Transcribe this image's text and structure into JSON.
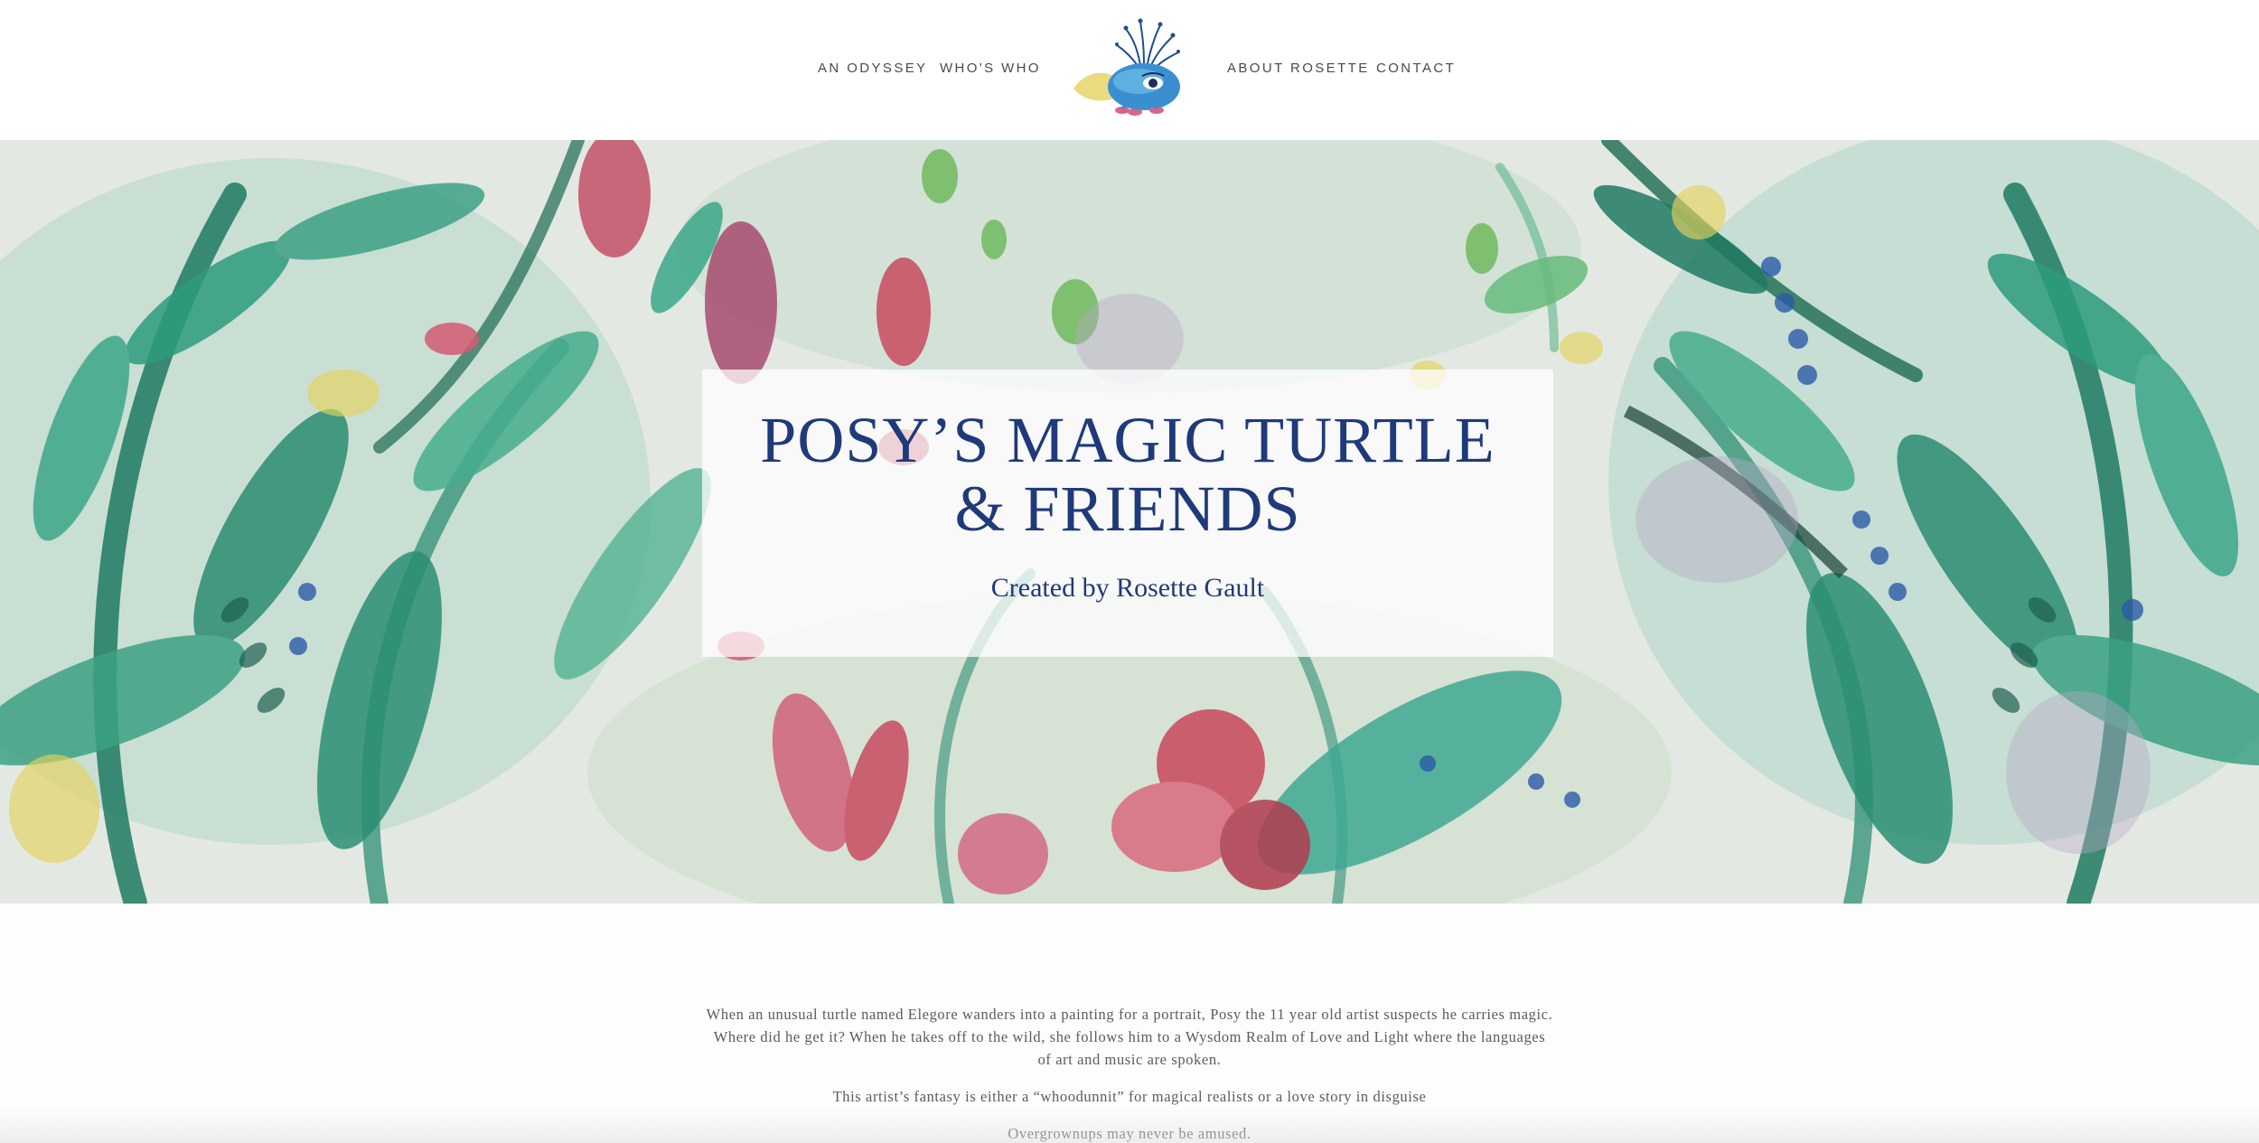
{
  "nav": {
    "left_items": [
      {
        "label": "AN ODYSSEY"
      },
      {
        "label": "WHO'S WHO"
      }
    ],
    "right_items": [
      {
        "label": "ABOUT ROSETTE"
      },
      {
        "label": "CONTACT"
      }
    ],
    "logo_icon": "turtle-creature-logo-icon"
  },
  "hero": {
    "title_line1": "POSY’S MAGIC TURTLE",
    "title_line2": "& FRIENDS",
    "subtitle": "Created by Rosette Gault",
    "background_icon": "watercolor-foliage-painting"
  },
  "content": {
    "paragraphs": [
      "When an unusual turtle named Elegore wanders into a painting for a portrait, Posy the 11 year old artist suspects he carries magic. Where did he get it? When he takes off to the wild, she follows him to a Wysdom Realm of Love and Light where the languages of art and music are spoken.",
      "This artist’s fantasy is either a “whoodunnit” for magical realists or a love story in disguise",
      "Overgrownups may never be amused."
    ]
  },
  "colors": {
    "title": "#1f3a7a",
    "nav_text": "#4a4a4a",
    "body_text": "#5c5c5c",
    "leaf_green": "#2f9a7c",
    "leaf_dark": "#1d6e55",
    "flower_red": "#c84a5e",
    "accent_blue": "#2b5aa8"
  }
}
